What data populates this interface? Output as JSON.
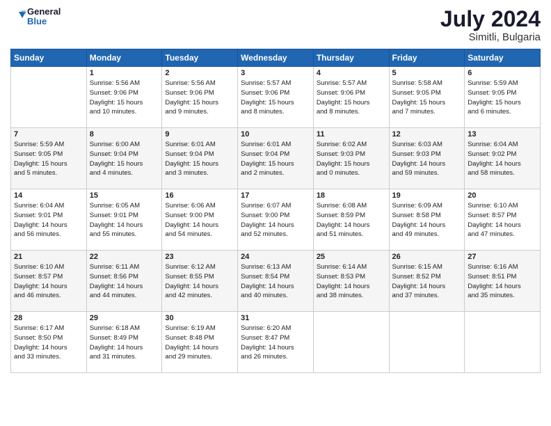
{
  "header": {
    "logo_line1": "General",
    "logo_line2": "Blue",
    "month_year": "July 2024",
    "location": "Simitli, Bulgaria"
  },
  "weekdays": [
    "Sunday",
    "Monday",
    "Tuesday",
    "Wednesday",
    "Thursday",
    "Friday",
    "Saturday"
  ],
  "weeks": [
    [
      {
        "day": "",
        "info": ""
      },
      {
        "day": "1",
        "info": "Sunrise: 5:56 AM\nSunset: 9:06 PM\nDaylight: 15 hours\nand 10 minutes."
      },
      {
        "day": "2",
        "info": "Sunrise: 5:56 AM\nSunset: 9:06 PM\nDaylight: 15 hours\nand 9 minutes."
      },
      {
        "day": "3",
        "info": "Sunrise: 5:57 AM\nSunset: 9:06 PM\nDaylight: 15 hours\nand 8 minutes."
      },
      {
        "day": "4",
        "info": "Sunrise: 5:57 AM\nSunset: 9:06 PM\nDaylight: 15 hours\nand 8 minutes."
      },
      {
        "day": "5",
        "info": "Sunrise: 5:58 AM\nSunset: 9:05 PM\nDaylight: 15 hours\nand 7 minutes."
      },
      {
        "day": "6",
        "info": "Sunrise: 5:59 AM\nSunset: 9:05 PM\nDaylight: 15 hours\nand 6 minutes."
      }
    ],
    [
      {
        "day": "7",
        "info": "Sunrise: 5:59 AM\nSunset: 9:05 PM\nDaylight: 15 hours\nand 5 minutes."
      },
      {
        "day": "8",
        "info": "Sunrise: 6:00 AM\nSunset: 9:04 PM\nDaylight: 15 hours\nand 4 minutes."
      },
      {
        "day": "9",
        "info": "Sunrise: 6:01 AM\nSunset: 9:04 PM\nDaylight: 15 hours\nand 3 minutes."
      },
      {
        "day": "10",
        "info": "Sunrise: 6:01 AM\nSunset: 9:04 PM\nDaylight: 15 hours\nand 2 minutes."
      },
      {
        "day": "11",
        "info": "Sunrise: 6:02 AM\nSunset: 9:03 PM\nDaylight: 15 hours\nand 0 minutes."
      },
      {
        "day": "12",
        "info": "Sunrise: 6:03 AM\nSunset: 9:03 PM\nDaylight: 14 hours\nand 59 minutes."
      },
      {
        "day": "13",
        "info": "Sunrise: 6:04 AM\nSunset: 9:02 PM\nDaylight: 14 hours\nand 58 minutes."
      }
    ],
    [
      {
        "day": "14",
        "info": "Sunrise: 6:04 AM\nSunset: 9:01 PM\nDaylight: 14 hours\nand 56 minutes."
      },
      {
        "day": "15",
        "info": "Sunrise: 6:05 AM\nSunset: 9:01 PM\nDaylight: 14 hours\nand 55 minutes."
      },
      {
        "day": "16",
        "info": "Sunrise: 6:06 AM\nSunset: 9:00 PM\nDaylight: 14 hours\nand 54 minutes."
      },
      {
        "day": "17",
        "info": "Sunrise: 6:07 AM\nSunset: 9:00 PM\nDaylight: 14 hours\nand 52 minutes."
      },
      {
        "day": "18",
        "info": "Sunrise: 6:08 AM\nSunset: 8:59 PM\nDaylight: 14 hours\nand 51 minutes."
      },
      {
        "day": "19",
        "info": "Sunrise: 6:09 AM\nSunset: 8:58 PM\nDaylight: 14 hours\nand 49 minutes."
      },
      {
        "day": "20",
        "info": "Sunrise: 6:10 AM\nSunset: 8:57 PM\nDaylight: 14 hours\nand 47 minutes."
      }
    ],
    [
      {
        "day": "21",
        "info": "Sunrise: 6:10 AM\nSunset: 8:57 PM\nDaylight: 14 hours\nand 46 minutes."
      },
      {
        "day": "22",
        "info": "Sunrise: 6:11 AM\nSunset: 8:56 PM\nDaylight: 14 hours\nand 44 minutes."
      },
      {
        "day": "23",
        "info": "Sunrise: 6:12 AM\nSunset: 8:55 PM\nDaylight: 14 hours\nand 42 minutes."
      },
      {
        "day": "24",
        "info": "Sunrise: 6:13 AM\nSunset: 8:54 PM\nDaylight: 14 hours\nand 40 minutes."
      },
      {
        "day": "25",
        "info": "Sunrise: 6:14 AM\nSunset: 8:53 PM\nDaylight: 14 hours\nand 38 minutes."
      },
      {
        "day": "26",
        "info": "Sunrise: 6:15 AM\nSunset: 8:52 PM\nDaylight: 14 hours\nand 37 minutes."
      },
      {
        "day": "27",
        "info": "Sunrise: 6:16 AM\nSunset: 8:51 PM\nDaylight: 14 hours\nand 35 minutes."
      }
    ],
    [
      {
        "day": "28",
        "info": "Sunrise: 6:17 AM\nSunset: 8:50 PM\nDaylight: 14 hours\nand 33 minutes."
      },
      {
        "day": "29",
        "info": "Sunrise: 6:18 AM\nSunset: 8:49 PM\nDaylight: 14 hours\nand 31 minutes."
      },
      {
        "day": "30",
        "info": "Sunrise: 6:19 AM\nSunset: 8:48 PM\nDaylight: 14 hours\nand 29 minutes."
      },
      {
        "day": "31",
        "info": "Sunrise: 6:20 AM\nSunset: 8:47 PM\nDaylight: 14 hours\nand 26 minutes."
      },
      {
        "day": "",
        "info": ""
      },
      {
        "day": "",
        "info": ""
      },
      {
        "day": "",
        "info": ""
      }
    ]
  ]
}
